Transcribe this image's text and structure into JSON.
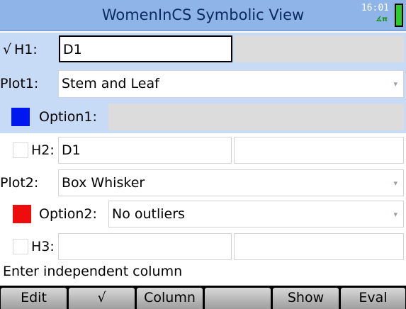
{
  "header": {
    "title": "WomenInCS Symbolic View",
    "clock": "16:01",
    "angle_mode": "∡π"
  },
  "rows": {
    "h1": {
      "checked": true,
      "check_glyph": "√",
      "label": "H1:",
      "value": "D1",
      "value2": ""
    },
    "plot1": {
      "label": "Plot1:",
      "value": "Stem and Leaf"
    },
    "option1": {
      "label": "Option1:",
      "value": "",
      "color": "#0018f0"
    },
    "h2": {
      "checked": false,
      "label": "H2:",
      "value": "D1",
      "value2": ""
    },
    "plot2": {
      "label": "Plot2:",
      "value": "Box Whisker"
    },
    "option2": {
      "label": "Option2:",
      "value": "No outliers",
      "color": "#ee0d0d"
    },
    "h3": {
      "checked": false,
      "label": "H3:",
      "value": "",
      "value2": ""
    }
  },
  "help_text": "Enter independent column",
  "menu": [
    "Edit",
    "√",
    "Column",
    "",
    "Show",
    "Eval"
  ],
  "dropdown_glyph": "▾"
}
